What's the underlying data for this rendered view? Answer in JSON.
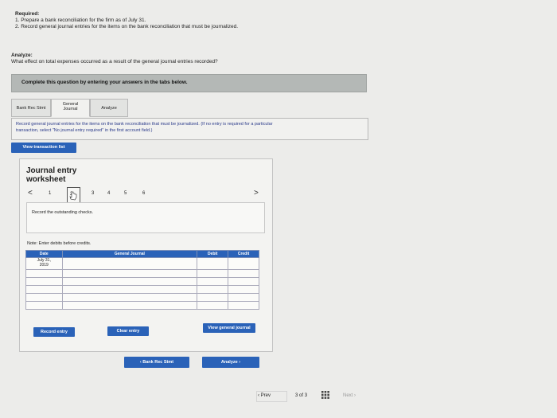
{
  "required": {
    "heading": "Required:",
    "items": [
      "1. Prepare a bank reconciliation for the firm as of July 31.",
      "2. Record general journal entries for the items on the bank reconciliation that must be journalized."
    ]
  },
  "analyze": {
    "heading": "Analyze:",
    "question": "What effect on total expenses occurred as a result of the general journal entries recorded?"
  },
  "banner": "Complete this question by entering your answers in the tabs below.",
  "tabs": [
    {
      "label": "Bank Rec Stmt"
    },
    {
      "line1": "General",
      "line2": "Journal"
    },
    {
      "label": "Analyze"
    }
  ],
  "instructions": {
    "line1": "Record general journal entries for the items on the bank reconciliation that must be journalized. (If no entry is required for a particular",
    "line2": "transaction, select \"No journal entry required\" in the first account field.)"
  },
  "view_transaction_list": "View transaction list",
  "worksheet": {
    "title_line1": "Journal entry",
    "title_line2": "worksheet",
    "pages": [
      "1",
      "2",
      "3",
      "4",
      "5",
      "6"
    ],
    "prev_arrow": "<",
    "next_arrow": ">",
    "description": "Record the outstanding checks.",
    "note": "Note: Enter debits before credits.",
    "table": {
      "headers": {
        "date": "Date",
        "journal": "General Journal",
        "debit": "Debit",
        "credit": "Credit"
      },
      "date_value_line1": "July 31,",
      "date_value_line2": "2019"
    },
    "record_entry": "Record entry",
    "clear_entry": "Clear entry",
    "view_general_journal": "View general journal"
  },
  "tab_nav": {
    "back": "Bank Rec Stmt",
    "forward": "Analyze"
  },
  "bottom_nav": {
    "prev": "Prev",
    "page": "3",
    "of": "of",
    "total": "3",
    "next": "Next"
  },
  "colors": {
    "accent_blue": "#2a62b8",
    "banner_gray": "#b4b8b6"
  }
}
